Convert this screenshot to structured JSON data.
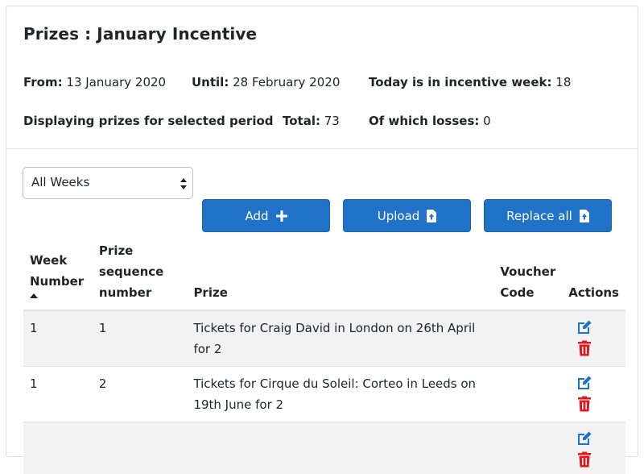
{
  "header": {
    "title": "Prizes : January Incentive"
  },
  "info": {
    "from_label": "From:",
    "from_value": "13 January 2020",
    "until_label": "Until:",
    "until_value": "28 February 2020",
    "week_label": "Today is in incentive week:",
    "week_value": "18",
    "displaying_label": "Displaying prizes for selected period",
    "total_label": "Total:",
    "total_value": "73",
    "losses_label": "Of which losses:",
    "losses_value": "0"
  },
  "filter": {
    "selected": "All Weeks"
  },
  "toolbar": {
    "add_label": "Add",
    "upload_label": "Upload",
    "replace_label": "Replace all",
    "primary_color": "#1f72c7"
  },
  "table": {
    "headers": {
      "week": [
        "Week",
        "Number"
      ],
      "seq": [
        "Prize",
        "sequence",
        "number"
      ],
      "prize": "Prize",
      "voucher": [
        "Voucher",
        "Code"
      ],
      "actions": "Actions"
    },
    "rows": [
      {
        "week": "1",
        "seq": "1",
        "prize": "Tickets for Craig David in London on 26th April for 2",
        "voucher": ""
      },
      {
        "week": "1",
        "seq": "2",
        "prize": "Tickets for Cirque du Soleil: Corteo in Leeds on 19th June for 2",
        "voucher": ""
      },
      {
        "week": "",
        "seq": "",
        "prize": "",
        "voucher": ""
      }
    ],
    "edit_color": "#1f72c7",
    "delete_color": "#e0191e"
  }
}
